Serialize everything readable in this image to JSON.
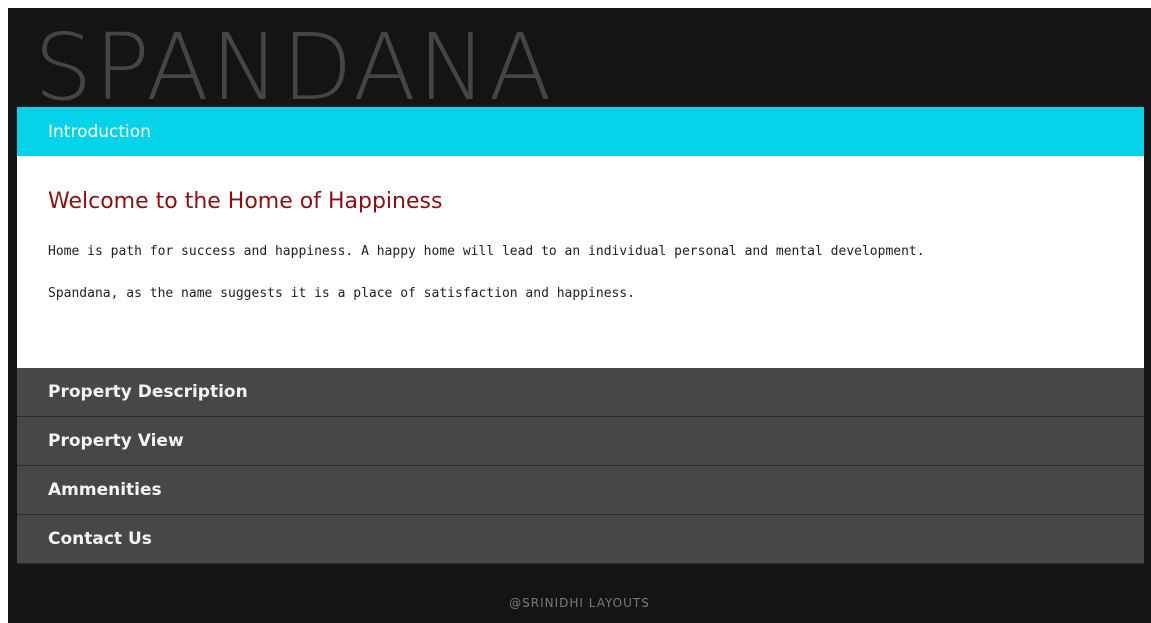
{
  "site": {
    "logo_text": "SPANDANA"
  },
  "accordion": {
    "active_section": {
      "label": "Introduction",
      "heading": "Welcome to the Home of Happiness",
      "paragraphs": [
        "Home is path for success and happiness. A happy home will lead to an individual personal and mental development.",
        "Spandana, as the name suggests it is a place of satisfaction and happiness."
      ]
    },
    "sections": [
      {
        "label": "Property Description"
      },
      {
        "label": "Property View"
      },
      {
        "label": "Ammenities"
      },
      {
        "label": "Contact Us"
      }
    ]
  },
  "footer": {
    "text": "@SRINIDHI LAYOUTS"
  },
  "colors": {
    "page_background": "#141414",
    "active_header": "#06d3ea",
    "inactive_header": "#474747",
    "heading": "#8b1010",
    "logo": "#454545"
  }
}
